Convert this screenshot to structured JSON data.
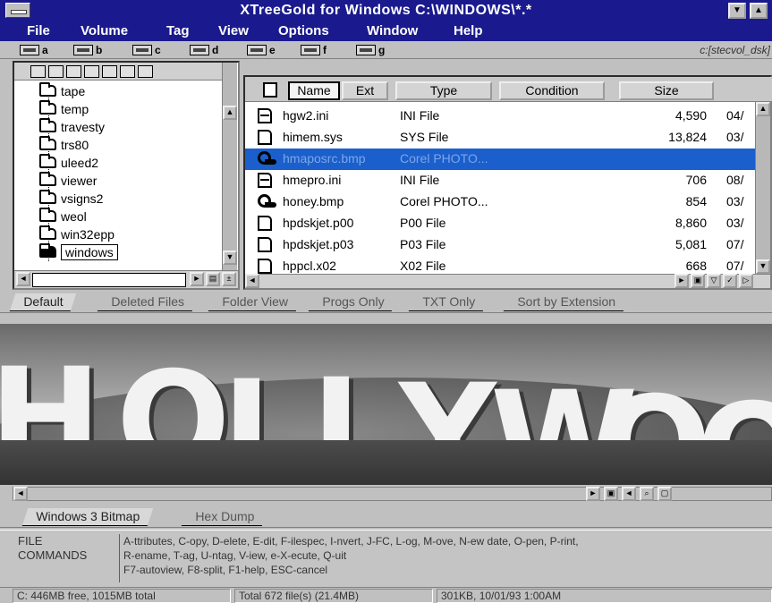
{
  "window": {
    "title": "XTreeGold for Windows   C:\\WINDOWS\\*.*"
  },
  "menu": [
    "File",
    "Volume",
    "Tag",
    "View",
    "Options",
    "Window",
    "Help"
  ],
  "drives": [
    "a",
    "b",
    "c",
    "d",
    "e",
    "f",
    "g"
  ],
  "drivebar_path": "c:[stecvol_dsk]",
  "tree": {
    "items": [
      "tape",
      "temp",
      "travesty",
      "trs80",
      "uleed2",
      "viewer",
      "vsigns2",
      "weol",
      "win32epp",
      "windows"
    ],
    "selected": "windows"
  },
  "columns": {
    "name": "Name",
    "ext": "Ext",
    "type": "Type",
    "condition": "Condition",
    "size": "Size"
  },
  "files": [
    {
      "name": "hgw2.ini",
      "type": "INI File",
      "size": "4,590",
      "date": "04/",
      "icon": "ini-file-icon"
    },
    {
      "name": "himem.sys",
      "type": "SYS File",
      "size": "13,824",
      "date": "03/",
      "icon": "document-icon"
    },
    {
      "name": "hmaposrc.bmp",
      "type": "Corel PHOTO...",
      "size": "",
      "date": "",
      "icon": "image-file-icon",
      "selected": true
    },
    {
      "name": "hmepro.ini",
      "type": "INI File",
      "size": "706",
      "date": "08/",
      "icon": "ini-file-icon"
    },
    {
      "name": "honey.bmp",
      "type": "Corel PHOTO...",
      "size": "854",
      "date": "03/",
      "icon": "image-file-icon"
    },
    {
      "name": "hpdskjet.p00",
      "type": "P00 File",
      "size": "8,860",
      "date": "03/",
      "icon": "document-icon"
    },
    {
      "name": "hpdskjet.p03",
      "type": "P03 File",
      "size": "5,081",
      "date": "07/",
      "icon": "document-icon"
    },
    {
      "name": "hppcl.x02",
      "type": "X02 File",
      "size": "668",
      "date": "07/",
      "icon": "document-icon"
    }
  ],
  "filter_tabs": [
    "Default",
    "Deleted Files",
    "Folder View",
    "Progs Only",
    "TXT Only",
    "Sort by Extension"
  ],
  "viewer": {
    "image_text": "HOLLYWOO"
  },
  "viewer_tabs": [
    "Windows 3 Bitmap",
    "Hex Dump"
  ],
  "commands": {
    "label_line1": "FILE",
    "label_line2": "COMMANDS",
    "line1": "A-ttributes, C-opy, D-elete, E-dit, F-ilespec, I-nvert, J-FC, L-og, M-ove, N-ew date, O-pen, P-rint,",
    "line2": "R-ename, T-ag, U-ntag, V-iew, e-X-ecute, Q-uit",
    "line3": "F7-autoview, F8-split, F1-help, ESC-cancel"
  },
  "status": {
    "disk": "C: 446MB free, 1015MB total",
    "total": "Total 672 file(s) (21.4MB)",
    "current": "301KB, 10/01/93 1:00AM"
  },
  "colors": {
    "titlebar": "#1a1a8e",
    "selection": "#1a5fcc",
    "chrome": "#c0c0c0"
  }
}
